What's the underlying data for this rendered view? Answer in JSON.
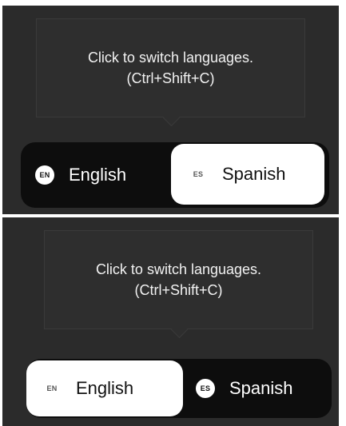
{
  "states": [
    {
      "tooltip": {
        "line1": "Click to switch languages.",
        "line2": "(Ctrl+Shift+C)"
      },
      "options": [
        {
          "code": "EN",
          "label": "English",
          "selected": false
        },
        {
          "code": "ES",
          "label": "Spanish",
          "selected": true
        }
      ]
    },
    {
      "tooltip": {
        "line1": "Click to switch languages.",
        "line2": "(Ctrl+Shift+C)"
      },
      "options": [
        {
          "code": "EN",
          "label": "English",
          "selected": true
        },
        {
          "code": "ES",
          "label": "Spanish",
          "selected": false
        }
      ]
    }
  ],
  "colors": {
    "panel_background": "#2b2b2b",
    "switcher_background": "#0d0d0d",
    "selected_background": "#ffffff",
    "text_light": "#f2f2f2",
    "text_dark": "#111111"
  }
}
